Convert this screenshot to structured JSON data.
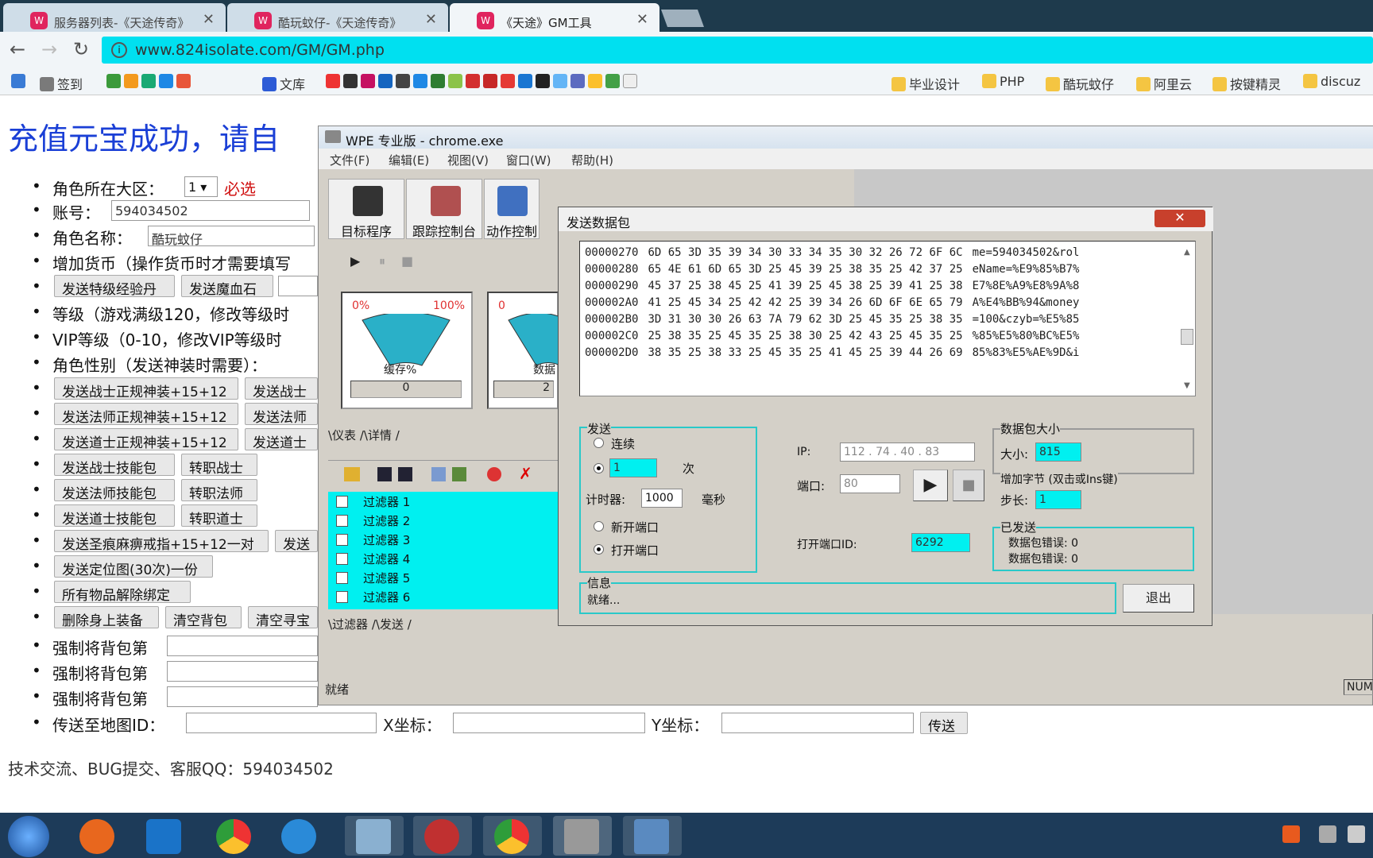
{
  "browser": {
    "tabs": [
      {
        "title": "服务器列表-《天途传奇》"
      },
      {
        "title": "酷玩蚊仔-《天途传奇》"
      },
      {
        "title": "《天途》GM工具"
      }
    ],
    "url": "www.824isolate.com/GM/GM.php",
    "bookmarks": [
      "签到",
      "文库",
      "毕业设计",
      "PHP",
      "酷玩蚊仔",
      "阿里云",
      "按键精灵",
      "discuz"
    ]
  },
  "page": {
    "title": "充值元宝成功，请自",
    "items": [
      {
        "label": "角色所在大区：",
        "select": "1",
        "required": "必选"
      },
      {
        "label": "账号：",
        "value": "594034502"
      },
      {
        "label": "角色名称：",
        "value": "酷玩蚊仔"
      },
      {
        "label": "增加货币（操作货币时才需要填写"
      },
      {
        "buttons": [
          "发送特级经验丹",
          "发送魔血石"
        ]
      },
      {
        "label": "等级（游戏满级120，修改等级时"
      },
      {
        "label": "VIP等级（0-10，修改VIP等级时"
      },
      {
        "label": "角色性别（发送神装时需要）："
      },
      {
        "buttons": [
          "发送战士正规神装+15+12",
          "发送战士"
        ]
      },
      {
        "buttons": [
          "发送法师正规神装+15+12",
          "发送法师"
        ]
      },
      {
        "buttons": [
          "发送道士正规神装+15+12",
          "发送道士"
        ]
      },
      {
        "buttons": [
          "发送战士技能包",
          "转职战士"
        ]
      },
      {
        "buttons": [
          "发送法师技能包",
          "转职法师"
        ]
      },
      {
        "buttons": [
          "发送道士技能包",
          "转职道士"
        ]
      },
      {
        "buttons": [
          "发送圣痕麻痹戒指+15+12一对",
          "发送"
        ]
      },
      {
        "buttons": [
          "发送定位图(30次)一份"
        ]
      },
      {
        "buttons": [
          "所有物品解除绑定"
        ]
      },
      {
        "buttons": [
          "删除身上装备",
          "清空背包",
          "清空寻宝"
        ]
      },
      {
        "label": "强制将背包第"
      },
      {
        "label": "强制将背包第"
      },
      {
        "label": "强制将背包第"
      }
    ],
    "teleport": {
      "label": "传送至地图ID：",
      "x_label": "X坐标：",
      "y_label": "Y坐标：",
      "button": "传送"
    },
    "footer": "技术交流、BUG提交、客服QQ：594034502"
  },
  "wpe": {
    "title": "WPE 专业版 - chrome.exe",
    "menus": [
      "文件(F)",
      "编辑(E)",
      "视图(V)",
      "窗口(W)",
      "帮助(H)"
    ],
    "tools": [
      "目标程序",
      "跟踪控制台",
      "动作控制"
    ],
    "gauge1": {
      "min": "0%",
      "max": "100%",
      "label": "缓存%",
      "value": "0"
    },
    "gauge2": {
      "min": "0",
      "label": "数据",
      "value": "2"
    },
    "tabs1": "\\仪表 /\\详情 /",
    "filters": [
      "过滤器 1",
      "过滤器 2",
      "过滤器 3",
      "过滤器 4",
      "过滤器 5",
      "过滤器 6"
    ],
    "tabs2": "\\过滤器 /\\发送 /",
    "status": "就绪",
    "num": "NUM"
  },
  "send": {
    "title": "发送数据包",
    "close": "✕",
    "hex": [
      {
        "offset": "00000270",
        "bytes": "6D 65 3D 35 39 34 30 33 34 35 30 32 26 72 6F 6C",
        "ascii": "me=594034502&rol"
      },
      {
        "offset": "00000280",
        "bytes": "65 4E 61 6D 65 3D 25 45 39 25 38 35 25 42 37 25",
        "ascii": "eName=%E9%85%B7%"
      },
      {
        "offset": "00000290",
        "bytes": "45 37 25 38 45 25 41 39 25 45 38 25 39 41 25 38",
        "ascii": "E7%8E%A9%E8%9A%8"
      },
      {
        "offset": "000002A0",
        "bytes": "41 25 45 34 25 42 42 25 39 34 26 6D 6F 6E 65 79",
        "ascii": "A%E4%BB%94&money"
      },
      {
        "offset": "000002B0",
        "bytes": "3D 31 30 30 26 63 7A 79 62 3D 25 45 35 25 38 35",
        "ascii": "=100&czyb=%E5%85"
      },
      {
        "offset": "000002C0",
        "bytes": "25 38 35 25 45 35 25 38 30 25 42 43 25 45 35 25",
        "ascii": "%85%E5%80%BC%E5%"
      },
      {
        "offset": "000002D0",
        "bytes": "38 35 25 38 33 25 45 35 25 41 45 25 39 44 26 69",
        "ascii": "85%83%E5%AE%9D&i"
      }
    ],
    "send_group": "发送",
    "continuous": "连续",
    "times_value": "1",
    "times_unit": "次",
    "timer_label": "计时器:",
    "timer_value": "1000",
    "timer_unit": "毫秒",
    "new_port": "新开端口",
    "open_port": "打开端口",
    "ip_label": "IP:",
    "ip_value": "112 . 74 . 40 . 83",
    "port_label": "端口:",
    "port_value": "80",
    "open_port_id_label": "打开端口ID:",
    "open_port_id": "6292",
    "size_group": "数据包大小",
    "size_label": "大小:",
    "size_value": "815",
    "add_group": "增加字节 (双击或Ins键)",
    "step_label": "步长:",
    "step_value": "1",
    "sent_group": "已发送",
    "err1": "数据包错误: 0",
    "err2": "数据包错误: 0",
    "info_group": "信息",
    "info_value": "就绪...",
    "exit": "退出"
  }
}
